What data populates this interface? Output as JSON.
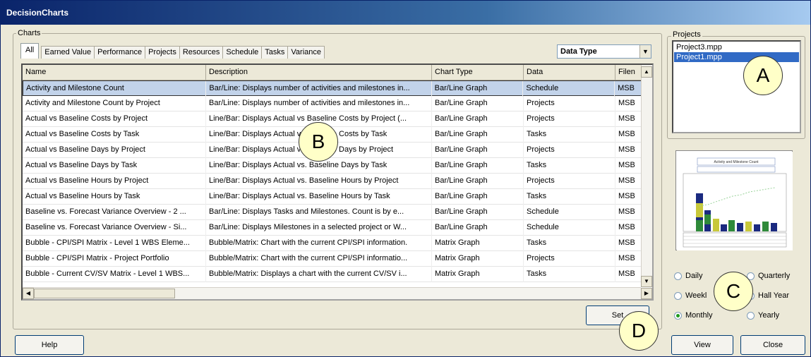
{
  "window": {
    "title": "DecisionCharts"
  },
  "charts_group": {
    "label": "Charts"
  },
  "tabs": [
    "All",
    "Earned Value",
    "Performance",
    "Projects",
    "Resources",
    "Schedule",
    "Tasks",
    "Variance"
  ],
  "data_type": {
    "selected": "Data Type"
  },
  "table": {
    "columns": [
      "Name",
      "Description",
      "Chart Type",
      "Data",
      "Filen"
    ],
    "rows": [
      [
        "Activity and Milestone Count",
        "Bar/Line: Displays number of activities and milestones in...",
        "Bar/Line Graph",
        "Schedule",
        "MSB"
      ],
      [
        "Activity and Milestone Count by Project",
        "Bar/Line: Displays number of activities and milestones in...",
        "Bar/Line Graph",
        "Projects",
        "MSB"
      ],
      [
        "Actual vs Baseline Costs by Project",
        "Line/Bar: Displays Actual vs Baseline Costs by Project (...",
        "Bar/Line Graph",
        "Projects",
        "MSB"
      ],
      [
        "Actual vs Baseline Costs by Task",
        "Line/Bar: Displays Actual vs Baseline Costs by Task",
        "Bar/Line Graph",
        "Tasks",
        "MSB"
      ],
      [
        "Actual vs Baseline Days by Project",
        "Line/Bar: Displays Actual vs Baseline Days by Project",
        "Bar/Line Graph",
        "Projects",
        "MSB"
      ],
      [
        "Actual vs Baseline Days by Task",
        "Line/Bar: Displays Actual vs. Baseline Days by Task",
        "Bar/Line Graph",
        "Tasks",
        "MSB"
      ],
      [
        "Actual vs Baseline Hours by Project",
        "Line/Bar: Displays Actual vs. Baseline Hours by Project",
        "Bar/Line Graph",
        "Projects",
        "MSB"
      ],
      [
        "Actual vs Baseline Hours by Task",
        "Line/Bar: Displays Actual vs. Baseline Hours by Task",
        "Bar/Line Graph",
        "Tasks",
        "MSB"
      ],
      [
        "Baseline vs. Forecast Variance Overview - 2 ...",
        "Bar/Line: Displays Tasks and Milestones.  Count is by e...",
        "Bar/Line Graph",
        "Schedule",
        "MSB"
      ],
      [
        "Baseline vs. Forecast Variance Overview - Si...",
        "Bar/Line: Displays Milestones in a selected project or W...",
        "Bar/Line Graph",
        "Schedule",
        "MSB"
      ],
      [
        "Bubble - CPI/SPI Matrix - Level 1 WBS Eleme...",
        "Bubble/Matrix: Chart with the current CPI/SPI information.",
        "Matrix Graph",
        "Tasks",
        "MSB"
      ],
      [
        "Bubble - CPI/SPI Matrix - Project Portfolio",
        "Bubble/Matrix: Chart with the current CPI/SPI informatio...",
        "Matrix Graph",
        "Projects",
        "MSB"
      ],
      [
        "Bubble - Current CV/SV Matrix - Level 1 WBS...",
        "Bubble/Matrix: Displays a chart with the current CV/SV i...",
        "Matrix Graph",
        "Tasks",
        "MSB"
      ]
    ]
  },
  "projects_group": {
    "label": "Projects",
    "items": [
      "Project3.mpp",
      "Project1.mpp"
    ]
  },
  "thumbnail": {
    "title": "Activity and Milestone Count"
  },
  "periods": {
    "daily": "Daily",
    "weekly": "Weekl",
    "monthly": "Monthly",
    "quarterly": "Quarterly",
    "half_year": "Hall Year",
    "yearly": "Yearly"
  },
  "buttons": {
    "help": "Help",
    "settings": "Set",
    "view": "View",
    "close": "Close"
  },
  "callouts": {
    "a": "A",
    "b": "B",
    "c": "C",
    "d": "D"
  },
  "colors": {
    "title_start": "#0a246a",
    "title_end": "#a6caf0",
    "face": "#ece9d8",
    "selection": "#316ac5",
    "callout_fill": "#ffffc8"
  }
}
